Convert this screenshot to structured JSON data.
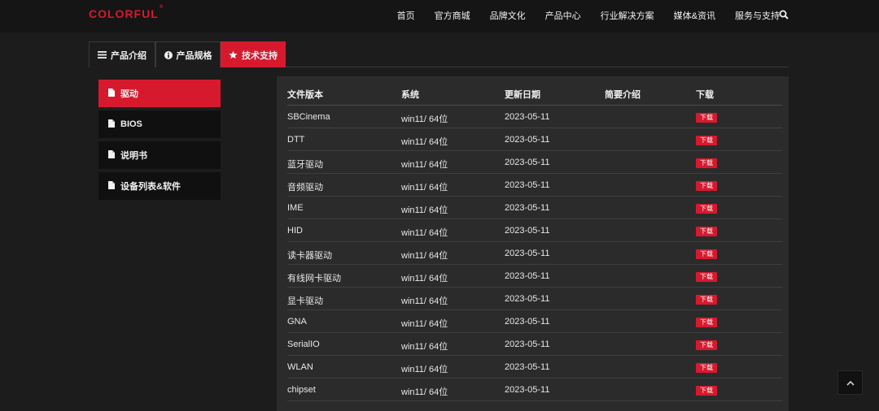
{
  "brand": {
    "logo_text": "COLORFUL",
    "logo_mark": "®",
    "accent": "#d7192e"
  },
  "nav": {
    "items": [
      "首页",
      "官方商城",
      "品牌文化",
      "产品中心",
      "行业解决方案",
      "媒体&资讯",
      "服务与支持"
    ],
    "search_icon": "search-icon"
  },
  "tabs": [
    {
      "label": "产品介绍",
      "icon": "bars-icon"
    },
    {
      "label": "产品规格",
      "icon": "info-icon"
    },
    {
      "label": "技术支持",
      "icon": "star-icon",
      "active": true
    }
  ],
  "sidebar": {
    "items": [
      {
        "label": "驱动",
        "active": true
      },
      {
        "label": "BIOS"
      },
      {
        "label": "说明书"
      },
      {
        "label": "设备列表&软件"
      }
    ]
  },
  "table": {
    "headers": [
      "文件版本",
      "系统",
      "更新日期",
      "简要介绍",
      "下载"
    ],
    "download_label": "下载",
    "rows": [
      [
        "SBCinema",
        "win11/ 64位",
        "2023-05-11",
        ""
      ],
      [
        "DTT",
        "win11/ 64位",
        "2023-05-11",
        ""
      ],
      [
        "蓝牙驱动",
        "win11/ 64位",
        "2023-05-11",
        ""
      ],
      [
        "音频驱动",
        "win11/ 64位",
        "2023-05-11",
        ""
      ],
      [
        "IME",
        "win11/ 64位",
        "2023-05-11",
        ""
      ],
      [
        "HID",
        "win11/ 64位",
        "2023-05-11",
        ""
      ],
      [
        "读卡器驱动",
        "win11/ 64位",
        "2023-05-11",
        ""
      ],
      [
        "有线网卡驱动",
        "win11/ 64位",
        "2023-05-11",
        ""
      ],
      [
        "显卡驱动",
        "win11/ 64位",
        "2023-05-11",
        ""
      ],
      [
        "GNA",
        "win11/ 64位",
        "2023-05-11",
        ""
      ],
      [
        "SerialIO",
        "win11/ 64位",
        "2023-05-11",
        ""
      ],
      [
        "WLAN",
        "win11/ 64位",
        "2023-05-11",
        ""
      ],
      [
        "chipset",
        "win11/ 64位",
        "2023-05-11",
        ""
      ]
    ]
  },
  "back_to_top_icon": "chevron-up-icon"
}
